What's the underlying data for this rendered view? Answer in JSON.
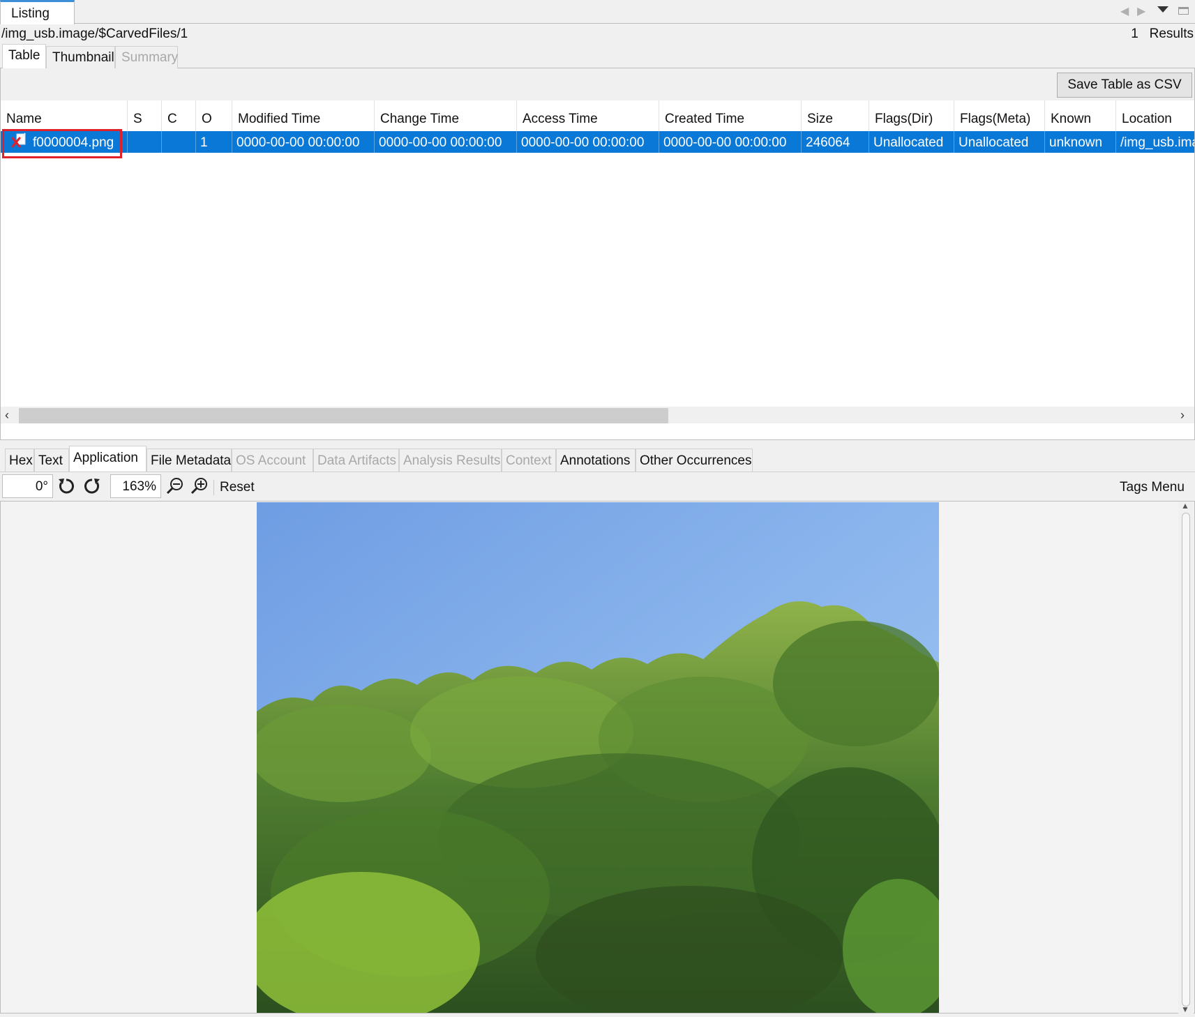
{
  "top_tab": {
    "label": "Listing"
  },
  "path": "/img_usb.image/$CarvedFiles/1",
  "results": {
    "count": "1",
    "label": "Results"
  },
  "result_tabs": [
    {
      "label": "Table",
      "state": "active"
    },
    {
      "label": "Thumbnail",
      "state": "normal"
    },
    {
      "label": "Summary",
      "state": "disabled"
    }
  ],
  "save_csv_label": "Save Table as CSV",
  "table": {
    "columns": [
      "Name",
      "S",
      "C",
      "O",
      "Modified Time",
      "Change Time",
      "Access Time",
      "Created Time",
      "Size",
      "Flags(Dir)",
      "Flags(Meta)",
      "Known",
      "Location"
    ],
    "rows": [
      {
        "name": "f0000004.png",
        "s": "",
        "c": "",
        "o": "1",
        "modified": "0000-00-00 00:00:00",
        "change": "0000-00-00 00:00:00",
        "access": "0000-00-00 00:00:00",
        "created": "0000-00-00 00:00:00",
        "size": "246064",
        "flags_dir": "Unallocated",
        "flags_meta": "Unallocated",
        "known": "unknown",
        "location": "/img_usb.ima"
      }
    ]
  },
  "content_tabs": [
    {
      "label": "Hex",
      "state": "normal"
    },
    {
      "label": "Text",
      "state": "normal"
    },
    {
      "label": "Application",
      "state": "active"
    },
    {
      "label": "File Metadata",
      "state": "normal"
    },
    {
      "label": "OS Account",
      "state": "disabled"
    },
    {
      "label": "Data Artifacts",
      "state": "disabled"
    },
    {
      "label": "Analysis Results",
      "state": "disabled"
    },
    {
      "label": "Context",
      "state": "disabled"
    },
    {
      "label": "Annotations",
      "state": "normal"
    },
    {
      "label": "Other Occurrences",
      "state": "normal"
    }
  ],
  "image_toolbar": {
    "rotation": "0°",
    "zoom": "163%",
    "reset_label": "Reset",
    "tags_menu_label": "Tags Menu",
    "icons": [
      "rotate-left-icon",
      "rotate-right-icon",
      "zoom-out-icon",
      "zoom-in-icon"
    ]
  },
  "colors": {
    "selection": "#0a78d7",
    "highlight_box": "#e0202a",
    "tab_accent": "#3c8fd6"
  }
}
